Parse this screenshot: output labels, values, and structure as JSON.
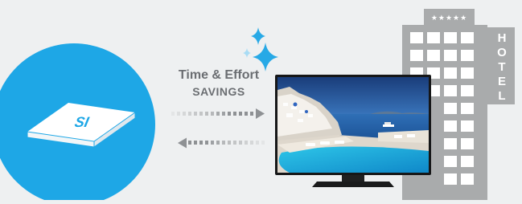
{
  "savings": {
    "line1": "Time & Effort",
    "line2": "SAVINGS"
  },
  "device": {
    "label": "SI"
  },
  "hotel": {
    "stars": "★★★★★",
    "sign_letters": [
      "H",
      "O",
      "T",
      "E",
      "L"
    ]
  },
  "colors": {
    "background": "#eef0f1",
    "circle": "#1ea7e6",
    "sparkle": "#27a9e6",
    "hotel": "#a9abac",
    "arrow": "#a6a8aa"
  }
}
